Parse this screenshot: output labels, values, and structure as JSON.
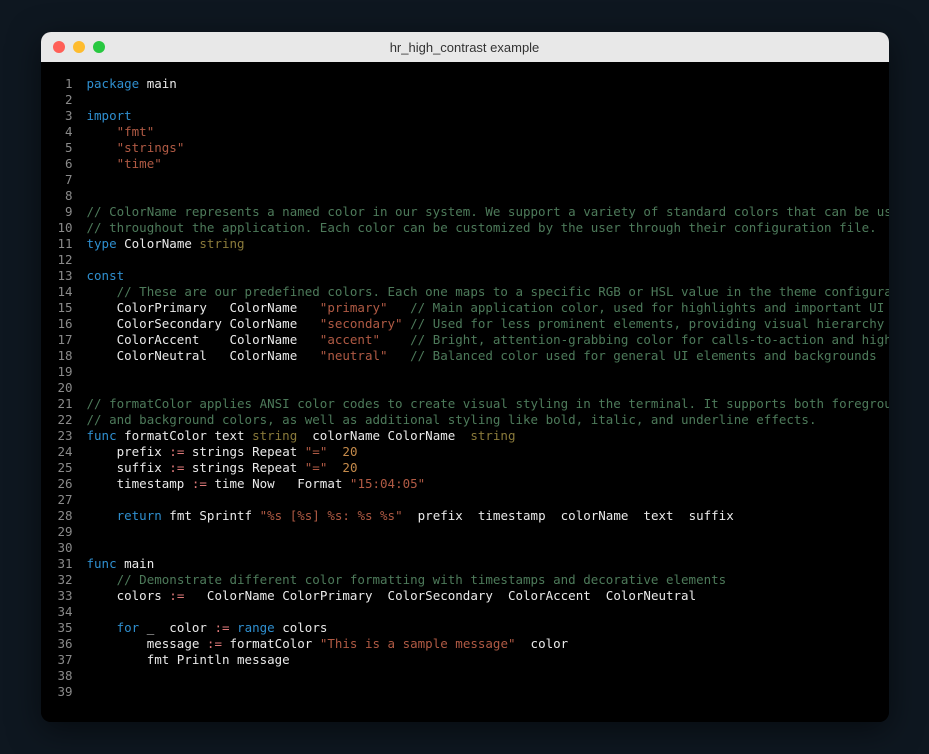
{
  "window": {
    "title": "hr_high_contrast example"
  },
  "colors": {
    "background": "#0e1720",
    "editor_bg": "#000000",
    "text": "#eaeaea",
    "keyword": "#2f8fcf",
    "type": "#8a7a3a",
    "string": "#b05a44",
    "comment": "#4d7a5a",
    "operator": "#e07a7a",
    "number": "#c48a4a",
    "lineno": "#8a8a8a",
    "titlebar": "#e8e8e8",
    "dot_red": "#ff5f57",
    "dot_yellow": "#febc2e",
    "dot_green": "#28c840"
  },
  "code": {
    "line_count": 39,
    "lines": [
      {
        "n": 1,
        "tokens": [
          [
            "keyword",
            "package"
          ],
          [
            "plain",
            " main"
          ]
        ]
      },
      {
        "n": 2,
        "tokens": []
      },
      {
        "n": 3,
        "tokens": [
          [
            "keyword",
            "import"
          ]
        ]
      },
      {
        "n": 4,
        "tokens": [
          [
            "plain",
            "    "
          ],
          [
            "string",
            "\"fmt\""
          ]
        ]
      },
      {
        "n": 5,
        "tokens": [
          [
            "plain",
            "    "
          ],
          [
            "string",
            "\"strings\""
          ]
        ]
      },
      {
        "n": 6,
        "tokens": [
          [
            "plain",
            "    "
          ],
          [
            "string",
            "\"time\""
          ]
        ]
      },
      {
        "n": 7,
        "tokens": []
      },
      {
        "n": 8,
        "tokens": []
      },
      {
        "n": 9,
        "tokens": [
          [
            "comment",
            "// ColorName represents a named color in our system. We support a variety of standard colors that can be used"
          ]
        ]
      },
      {
        "n": 10,
        "tokens": [
          [
            "comment",
            "// throughout the application. Each color can be customized by the user through their configuration file."
          ]
        ]
      },
      {
        "n": 11,
        "tokens": [
          [
            "keyword",
            "type"
          ],
          [
            "plain",
            " ColorName "
          ],
          [
            "type",
            "string"
          ]
        ]
      },
      {
        "n": 12,
        "tokens": []
      },
      {
        "n": 13,
        "tokens": [
          [
            "keyword",
            "const"
          ]
        ]
      },
      {
        "n": 14,
        "tokens": [
          [
            "plain",
            "    "
          ],
          [
            "comment",
            "// These are our predefined colors. Each one maps to a specific RGB or HSL value in the theme configuration."
          ]
        ]
      },
      {
        "n": 15,
        "tokens": [
          [
            "plain",
            "    ColorPrimary   ColorName   "
          ],
          [
            "string",
            "\"primary\""
          ],
          [
            "plain",
            "   "
          ],
          [
            "comment",
            "// Main application color, used for highlights and important UI elements"
          ]
        ]
      },
      {
        "n": 16,
        "tokens": [
          [
            "plain",
            "    ColorSecondary ColorName   "
          ],
          [
            "string",
            "\"secondary\""
          ],
          [
            "plain",
            " "
          ],
          [
            "comment",
            "// Used for less prominent elements, providing visual hierarchy"
          ]
        ]
      },
      {
        "n": 17,
        "tokens": [
          [
            "plain",
            "    ColorAccent    ColorName   "
          ],
          [
            "string",
            "\"accent\""
          ],
          [
            "plain",
            "    "
          ],
          [
            "comment",
            "// Bright, attention-grabbing color for calls-to-action and highlights"
          ]
        ]
      },
      {
        "n": 18,
        "tokens": [
          [
            "plain",
            "    ColorNeutral   ColorName   "
          ],
          [
            "string",
            "\"neutral\""
          ],
          [
            "plain",
            "   "
          ],
          [
            "comment",
            "// Balanced color used for general UI elements and backgrounds"
          ]
        ]
      },
      {
        "n": 19,
        "tokens": []
      },
      {
        "n": 20,
        "tokens": []
      },
      {
        "n": 21,
        "tokens": [
          [
            "comment",
            "// formatColor applies ANSI color codes to create visual styling in the terminal. It supports both foreground"
          ]
        ]
      },
      {
        "n": 22,
        "tokens": [
          [
            "comment",
            "// and background colors, as well as additional styling like bold, italic, and underline effects."
          ]
        ]
      },
      {
        "n": 23,
        "tokens": [
          [
            "keyword",
            "func"
          ],
          [
            "plain",
            " formatColor text "
          ],
          [
            "type",
            "string"
          ],
          [
            "plain",
            "  colorName ColorName  "
          ],
          [
            "type",
            "string"
          ]
        ]
      },
      {
        "n": 24,
        "tokens": [
          [
            "plain",
            "    prefix "
          ],
          [
            "op",
            ":="
          ],
          [
            "plain",
            " strings Repeat "
          ],
          [
            "string",
            "\"=\""
          ],
          [
            "plain",
            "  "
          ],
          [
            "number",
            "20"
          ]
        ]
      },
      {
        "n": 25,
        "tokens": [
          [
            "plain",
            "    suffix "
          ],
          [
            "op",
            ":="
          ],
          [
            "plain",
            " strings Repeat "
          ],
          [
            "string",
            "\"=\""
          ],
          [
            "plain",
            "  "
          ],
          [
            "number",
            "20"
          ]
        ]
      },
      {
        "n": 26,
        "tokens": [
          [
            "plain",
            "    timestamp "
          ],
          [
            "op",
            ":="
          ],
          [
            "plain",
            " time Now   Format "
          ],
          [
            "string",
            "\"15:04:05\""
          ]
        ]
      },
      {
        "n": 27,
        "tokens": []
      },
      {
        "n": 28,
        "tokens": [
          [
            "plain",
            "    "
          ],
          [
            "keyword",
            "return"
          ],
          [
            "plain",
            " fmt Sprintf "
          ],
          [
            "string",
            "\"%s [%s] %s: %s %s\""
          ],
          [
            "plain",
            "  prefix  timestamp  colorName  text  suffix"
          ]
        ]
      },
      {
        "n": 29,
        "tokens": []
      },
      {
        "n": 30,
        "tokens": []
      },
      {
        "n": 31,
        "tokens": [
          [
            "keyword",
            "func"
          ],
          [
            "plain",
            " main"
          ]
        ]
      },
      {
        "n": 32,
        "tokens": [
          [
            "plain",
            "    "
          ],
          [
            "comment",
            "// Demonstrate different color formatting with timestamps and decorative elements"
          ]
        ]
      },
      {
        "n": 33,
        "tokens": [
          [
            "plain",
            "    colors "
          ],
          [
            "op",
            ":="
          ],
          [
            "plain",
            "   ColorName ColorPrimary  ColorSecondary  ColorAccent  ColorNeutral"
          ]
        ]
      },
      {
        "n": 34,
        "tokens": []
      },
      {
        "n": 35,
        "tokens": [
          [
            "plain",
            "    "
          ],
          [
            "keyword",
            "for"
          ],
          [
            "plain",
            " _  color "
          ],
          [
            "op",
            ":="
          ],
          [
            "plain",
            " "
          ],
          [
            "keyword",
            "range"
          ],
          [
            "plain",
            " colors"
          ]
        ]
      },
      {
        "n": 36,
        "tokens": [
          [
            "plain",
            "        message "
          ],
          [
            "op",
            ":="
          ],
          [
            "plain",
            " formatColor "
          ],
          [
            "string",
            "\"This is a sample message\""
          ],
          [
            "plain",
            "  color"
          ]
        ]
      },
      {
        "n": 37,
        "tokens": [
          [
            "plain",
            "        fmt Println message"
          ]
        ]
      },
      {
        "n": 38,
        "tokens": []
      },
      {
        "n": 39,
        "tokens": []
      }
    ]
  }
}
